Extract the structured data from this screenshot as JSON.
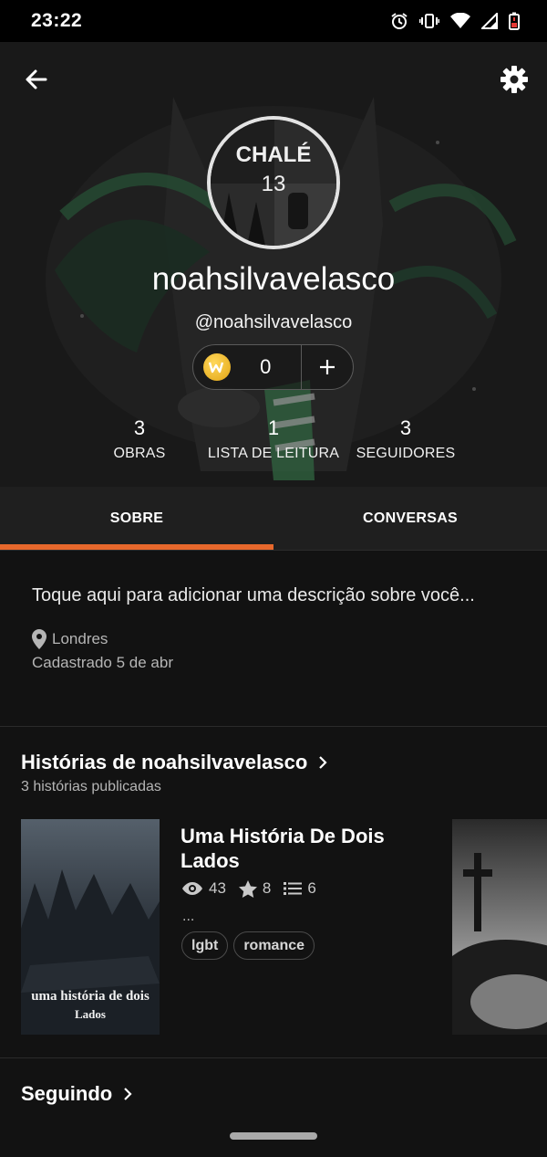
{
  "status_bar": {
    "time": "23:22",
    "icons": [
      "alarm-icon",
      "vibrate-icon",
      "wifi-icon",
      "signal-icon",
      "battery-low-icon"
    ]
  },
  "header": {
    "back_icon": "arrow-left-icon",
    "settings_icon": "gear-icon",
    "avatar_text_line1": "CHALÉ",
    "avatar_text_line2": "13",
    "display_name": "noahsilvavelasco",
    "handle": "@noahsilvavelasco",
    "coins": "0",
    "add_icon": "plus-icon"
  },
  "stats": [
    {
      "value": "3",
      "label": "OBRAS"
    },
    {
      "value": "1",
      "label": "LISTA DE LEITURA"
    },
    {
      "value": "3",
      "label": "SEGUIDORES"
    }
  ],
  "tabs": [
    {
      "label": "SOBRE",
      "active": true
    },
    {
      "label": "CONVERSAS",
      "active": false
    }
  ],
  "about": {
    "description_placeholder": "Toque aqui para adicionar uma descrição sobre você...",
    "location": "Londres",
    "joined": "Cadastrado 5 de abr"
  },
  "stories_section": {
    "title": "Histórias de noahsilvavelasco",
    "subtitle": "3 histórias publicadas",
    "stories": [
      {
        "title": "Uma História De Dois Lados",
        "reads": "43",
        "votes": "8",
        "parts": "6",
        "description": "...",
        "tags": [
          "lgbt",
          "romance"
        ],
        "cover_text_line1": "uma história de dois",
        "cover_text_line2": "Lados"
      }
    ]
  },
  "following_section": {
    "title": "Seguindo"
  },
  "colors": {
    "accent": "#e7682c",
    "background": "#121212",
    "coin": "#f2b01e"
  }
}
